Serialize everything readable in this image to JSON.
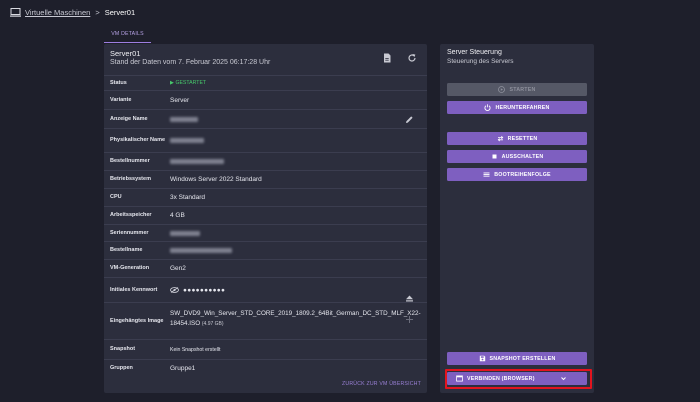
{
  "breadcrumb": {
    "link": "Virtuelle Maschinen",
    "separator": ">",
    "current": "Server01"
  },
  "tabs": [
    {
      "label": "VM DETAILS"
    }
  ],
  "details": {
    "title": "Server01",
    "subtitle": "Stand der Daten vom 7. Februar 2025 06:17:28 Uhr",
    "icons": {
      "document": "document-icon",
      "refresh": "refresh-icon"
    },
    "rows": {
      "status": {
        "label": "Status",
        "value": "GESTARTET"
      },
      "variant": {
        "label": "Variante",
        "value": "Server"
      },
      "display_name": {
        "label": "Anzeige Name"
      },
      "physical_name": {
        "label": "Physikalischer Name"
      },
      "order_number": {
        "label": "Bestellnummer"
      },
      "os": {
        "label": "Betriebssystem",
        "value": "Windows Server 2022 Standard"
      },
      "cpu": {
        "label": "CPU",
        "value": "3x Standard"
      },
      "memory": {
        "label": "Arbeitsspeicher",
        "value": "4 GB"
      },
      "serial": {
        "label": "Seriennummer"
      },
      "order_name": {
        "label": "Bestellname"
      },
      "generation": {
        "label": "VM-Generation",
        "value": "Gen2"
      },
      "password": {
        "label": "Initiales Kennwort",
        "value": "●●●●●●●●●●"
      },
      "iso": {
        "label": "Eingehängtes Image",
        "value": "SW_DVD9_Win_Server_STD_CORE_2019_1809.2_64Bit_German_DC_STD_MLF_X22-18454.ISO",
        "size": "(4.97 GB)"
      },
      "snapshot": {
        "label": "Snapshot",
        "value": "Kein Snapshot erstellt"
      },
      "groups": {
        "label": "Gruppen",
        "value": "Gruppe1"
      }
    },
    "back_link": "ZURÜCK ZUR VM ÜBERSICHT"
  },
  "control": {
    "title": "Server Steuerung",
    "subtitle": "Steuerung des Servers",
    "buttons": {
      "start": "STARTEN",
      "shutdown": "HERUNTERFAHREN",
      "reset": "RESETTEN",
      "power_off": "AUSSCHALTEN",
      "boot_order": "BOOTREIHENFOLGE",
      "snapshot": "SNAPSHOT ERSTELLEN",
      "connect": "VERBINDEN (BROWSER)"
    }
  },
  "colors": {
    "background": "#1e1f2b",
    "panel": "#2c2e3d",
    "accent": "#7e5fc0",
    "status_ok": "#47c96b",
    "highlight": "#e3141e"
  }
}
